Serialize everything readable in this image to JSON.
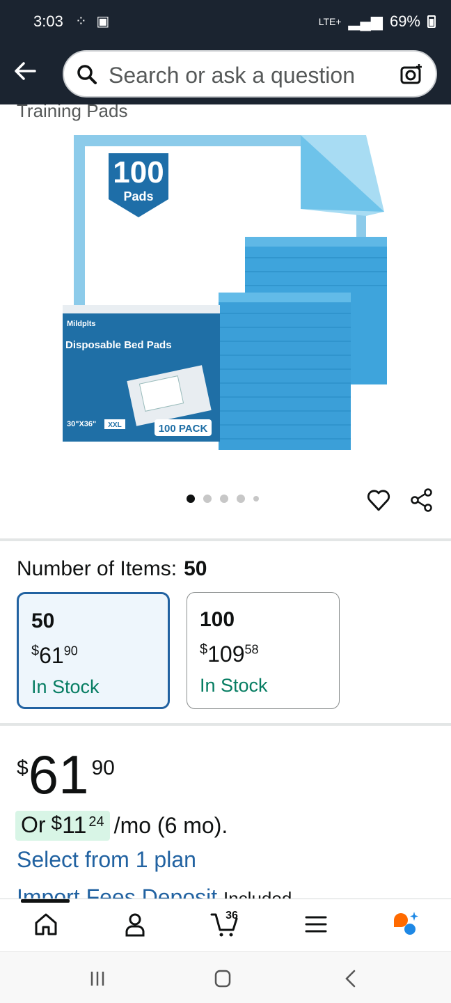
{
  "status_bar": {
    "time": "3:03",
    "network": "LTE+",
    "battery": "69%"
  },
  "search": {
    "placeholder": "Search or ask a question"
  },
  "product": {
    "title_fragment": "Training Pads",
    "image_text": {
      "count": "100",
      "count_label": "Pads",
      "brand": "Mildplts",
      "box_title": "Disposable Bed Pads",
      "size": "30\"X36\"",
      "size_badge": "XXL",
      "pack": "100 PACK"
    },
    "carousel": {
      "total": 5,
      "active": 0
    }
  },
  "items_selector": {
    "label": "Number of Items:",
    "selected": "50",
    "options": [
      {
        "name": "50",
        "currency": "$",
        "whole": "61",
        "fraction": "90",
        "stock": "In Stock",
        "selected": true
      },
      {
        "name": "100",
        "currency": "$",
        "whole": "109",
        "fraction": "58",
        "stock": "In Stock",
        "selected": false
      }
    ]
  },
  "price": {
    "currency": "$",
    "whole": "61",
    "fraction": "90"
  },
  "installment": {
    "prefix": "Or",
    "currency": "$",
    "whole": "11",
    "fraction": "24",
    "suffix": "/mo (6 mo)."
  },
  "plan_link": "Select from 1 plan",
  "import_fees": {
    "link": "Import Fees Deposit",
    "status": "Included"
  },
  "bottom_nav": {
    "cart_count": "36",
    "items": [
      "home-icon",
      "account-icon",
      "cart-icon",
      "menu-icon",
      "rufus-icon"
    ]
  },
  "colors": {
    "header": "#1b2430",
    "link": "#2162a1",
    "stock": "#067d62",
    "selected_border": "#2162a1",
    "highlight": "#d8f5e6"
  }
}
